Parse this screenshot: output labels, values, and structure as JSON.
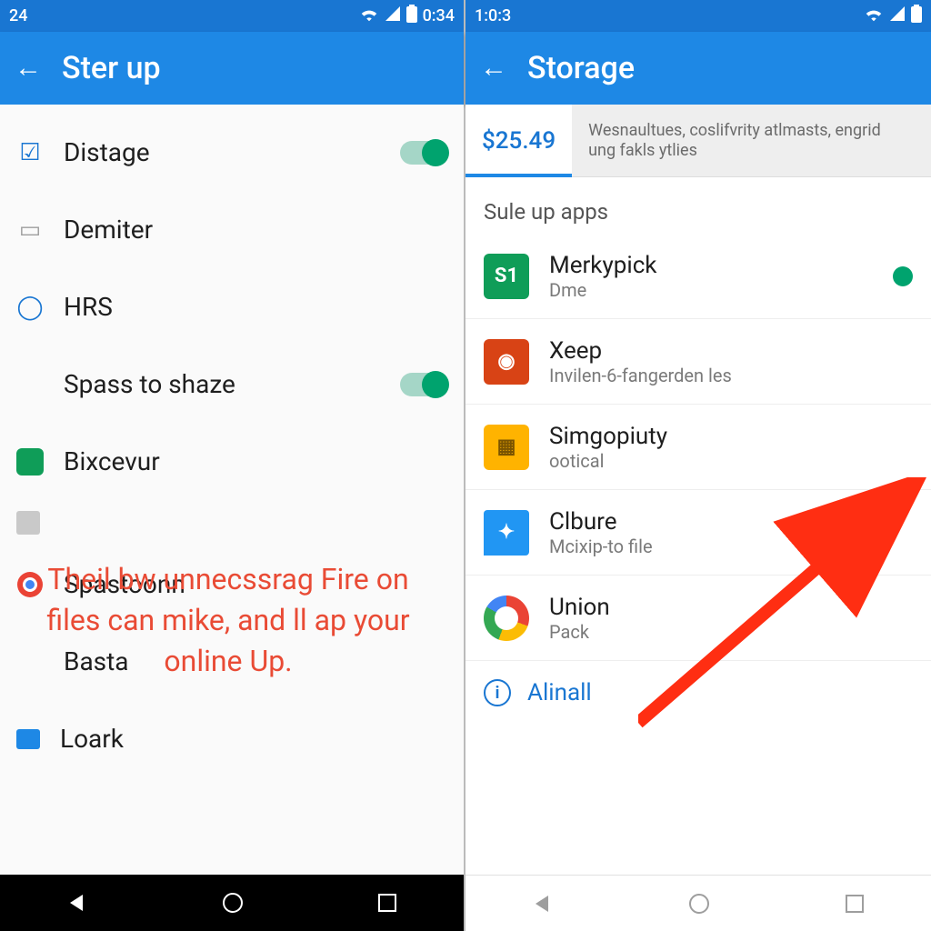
{
  "left": {
    "status_time": "0:34",
    "status_left": "24",
    "title": "Ster up",
    "items": [
      {
        "label": "Distage",
        "toggle": true
      },
      {
        "label": "Demiter",
        "toggle": false
      },
      {
        "label": "HRS",
        "toggle": false
      },
      {
        "label": "Spass to shaze",
        "toggle": true
      },
      {
        "label": "Bixcevur",
        "toggle": false
      },
      {
        "label": "Spastoonn",
        "toggle": false
      },
      {
        "label": "Basta",
        "toggle": false
      },
      {
        "label": "Loark",
        "toggle": false
      }
    ],
    "overlay": "Theil bw unnecssrag Fire on files can mike, and ll ap your online Up."
  },
  "right": {
    "status_time": "1:0:3",
    "title": "Storage",
    "tabs": {
      "active_amount": "$25.49",
      "other_desc": "Wesnaultues, coslifvrity atlmasts, engrid ung fakls ytlies"
    },
    "section": "Sule up apps",
    "apps": [
      {
        "name": "Merkypick",
        "sub": "Dme",
        "icon_bg": "ic-green",
        "icon_txt": "S1",
        "toggle": true
      },
      {
        "name": "Xeep",
        "sub": "Invilen-6-fangerden les",
        "icon_bg": "ic-red",
        "icon_txt": "◉"
      },
      {
        "name": "Simgopiuty",
        "sub": "ootical",
        "icon_bg": "ic-orange",
        "icon_txt": "▦"
      },
      {
        "name": "Clbure",
        "sub": "Mcixip-to file",
        "icon_bg": "ic-blue",
        "icon_txt": "✦"
      },
      {
        "name": "Union",
        "sub": "Pack",
        "icon_bg": "ic-ring",
        "icon_txt": ""
      }
    ],
    "footer": "Alinall"
  }
}
